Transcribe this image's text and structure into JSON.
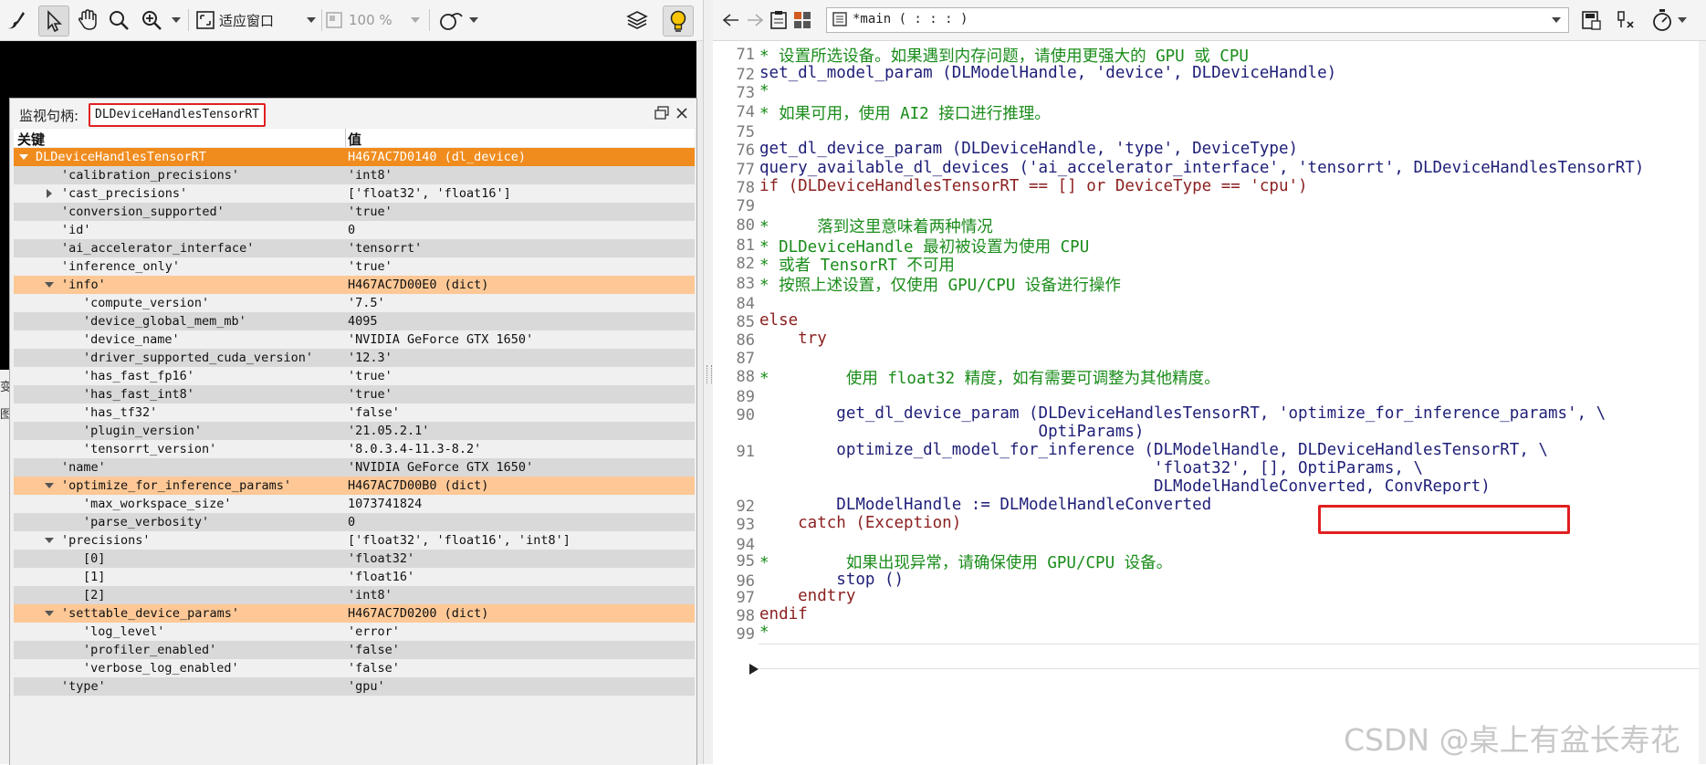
{
  "left_toolbar": {
    "zoom_mode": "适应窗口",
    "zoom_percent": "100 %",
    "icons": [
      "brush-icon",
      "pointer-icon",
      "hand-icon",
      "magnifier-icon",
      "zoom-in-icon",
      "fit-window-icon",
      "zoom-percent-icon",
      "region-icon",
      "layers-icon",
      "lightbulb-icon"
    ]
  },
  "left_strip_chars": [
    "变",
    "图"
  ],
  "watch": {
    "label": "监视句柄:",
    "handle": "DLDeviceHandlesTensorRT",
    "columns": {
      "key": "关键",
      "value": "值"
    },
    "rows": [
      {
        "key": "DLDeviceHandlesTensorRT",
        "value": "H467AC7D0140 (dl_device)"
      },
      {
        "key": "'calibration_precisions'",
        "value": "'int8'"
      },
      {
        "key": "'cast_precisions'",
        "value": "['float32', 'float16']"
      },
      {
        "key": "'conversion_supported'",
        "value": "'true'"
      },
      {
        "key": "'id'",
        "value": "0"
      },
      {
        "key": "'ai_accelerator_interface'",
        "value": "'tensorrt'"
      },
      {
        "key": "'inference_only'",
        "value": "'true'"
      },
      {
        "key": "'info'",
        "value": "H467AC7D00E0 (dict)"
      },
      {
        "key": "'compute_version'",
        "value": "'7.5'"
      },
      {
        "key": "'device_global_mem_mb'",
        "value": "4095"
      },
      {
        "key": "'device_name'",
        "value": "'NVIDIA GeForce GTX 1650'"
      },
      {
        "key": "'driver_supported_cuda_version'",
        "value": "'12.3'"
      },
      {
        "key": "'has_fast_fp16'",
        "value": "'true'"
      },
      {
        "key": "'has_fast_int8'",
        "value": "'true'"
      },
      {
        "key": "'has_tf32'",
        "value": "'false'"
      },
      {
        "key": "'plugin_version'",
        "value": "'21.05.2.1'"
      },
      {
        "key": "'tensorrt_version'",
        "value": "'8.0.3.4-11.3-8.2'"
      },
      {
        "key": "'name'",
        "value": "'NVIDIA GeForce GTX 1650'"
      },
      {
        "key": "'optimize_for_inference_params'",
        "value": "H467AC7D00B0 (dict)"
      },
      {
        "key": "'max_workspace_size'",
        "value": "1073741824"
      },
      {
        "key": "'parse_verbosity'",
        "value": "0"
      },
      {
        "key": "'precisions'",
        "value": "['float32', 'float16', 'int8']"
      },
      {
        "key": "[0]",
        "value": "'float32'"
      },
      {
        "key": "[1]",
        "value": "'float16'"
      },
      {
        "key": "[2]",
        "value": "'int8'"
      },
      {
        "key": "'settable_device_params'",
        "value": "H467AC7D0200 (dict)"
      },
      {
        "key": "'log_level'",
        "value": "'error'"
      },
      {
        "key": "'profiler_enabled'",
        "value": "'false'"
      },
      {
        "key": "'verbose_log_enabled'",
        "value": "'false'"
      },
      {
        "key": "'type'",
        "value": "'gpu'"
      }
    ]
  },
  "right_toolbar": {
    "procedure": "*main ( : : : )",
    "icons": [
      "back-icon",
      "forward-icon",
      "clipboard-icon",
      "grid-icon",
      "procedure-icon",
      "save-proc-icon",
      "clear-icon",
      "timer-icon"
    ]
  },
  "editor": {
    "lines": [
      {
        "n": "71",
        "t": "* 设置所选设备。如果遇到内存问题，请使用更强大的 GPU 或 CPU"
      },
      {
        "n": "72",
        "t": "set_dl_model_param (DLModelHandle, 'device', DLDeviceHandle)"
      },
      {
        "n": "73",
        "t": "*"
      },
      {
        "n": "74",
        "t": "* 如果可用，使用 AI2 接口进行推理。"
      },
      {
        "n": "75",
        "t": ""
      },
      {
        "n": "76",
        "t": "get_dl_device_param (DLDeviceHandle, 'type', DeviceType)"
      },
      {
        "n": "77",
        "t": "query_available_dl_devices ('ai_accelerator_interface', 'tensorrt', DLDeviceHandlesTensorRT)"
      },
      {
        "n": "78",
        "t": "if (DLDeviceHandlesTensorRT == [] or DeviceType == 'cpu')"
      },
      {
        "n": "79",
        "t": ""
      },
      {
        "n": "80",
        "t": "*     落到这里意味着两种情况"
      },
      {
        "n": "81",
        "t": "* DLDeviceHandle 最初被设置为使用 CPU"
      },
      {
        "n": "82",
        "t": "* 或者 TensorRT 不可用"
      },
      {
        "n": "83",
        "t": "* 按照上述设置，仅使用 GPU/CPU 设备进行操作"
      },
      {
        "n": "84",
        "t": ""
      },
      {
        "n": "85",
        "t": "else"
      },
      {
        "n": "86",
        "t": "    try"
      },
      {
        "n": "87",
        "t": ""
      },
      {
        "n": "88",
        "t": "*        使用 float32 精度，如有需要可调整为其他精度。"
      },
      {
        "n": "89",
        "t": ""
      },
      {
        "n": "90",
        "t": "        get_dl_device_param (DLDeviceHandlesTensorRT, 'optimize_for_inference_params', \\"
      },
      {
        "n": "",
        "t": "                             OptiParams)"
      },
      {
        "n": "91",
        "t": "        optimize_dl_model_for_inference (DLModelHandle, DLDeviceHandlesTensorRT, \\"
      },
      {
        "n": "",
        "t": "                                         'float32', [], OptiParams, \\"
      },
      {
        "n": "",
        "t": "                                         DLModelHandleConverted, ConvReport)"
      },
      {
        "n": "92",
        "t": "        DLModelHandle := DLModelHandleConverted"
      },
      {
        "n": "93",
        "t": "    catch (Exception)"
      },
      {
        "n": "94",
        "t": ""
      },
      {
        "n": "95",
        "t": "*        如果出现异常，请确保使用 GPU/CPU 设备。"
      },
      {
        "n": "96",
        "t": "        stop ()"
      },
      {
        "n": "97",
        "t": "    endtry"
      },
      {
        "n": "98",
        "t": "endif"
      },
      {
        "n": "99",
        "t": "*"
      }
    ]
  },
  "watermark": "CSDN @桌上有盆长寿花",
  "colors": {
    "selected_row": "#f08c1e",
    "dict_row": "#fdc896",
    "comment": "#1a8c1a",
    "keyword": "#8b1f1f",
    "code": "#1e1e78",
    "highlight_box": "#e02020"
  }
}
